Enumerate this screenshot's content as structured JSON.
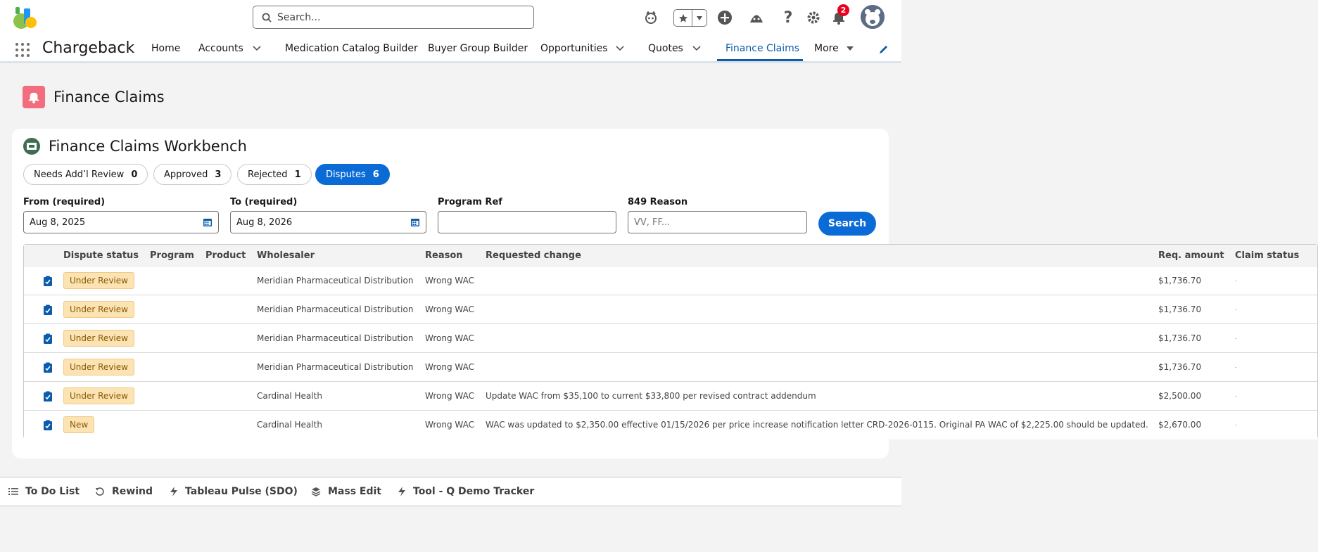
{
  "header": {
    "search_placeholder": "Search...",
    "notification_count": "2"
  },
  "nav": {
    "app_name": "Chargeback",
    "items": [
      {
        "label": "Home"
      },
      {
        "label": "Accounts"
      },
      {
        "label": "Medication Catalog Builder"
      },
      {
        "label": "Buyer Group Builder"
      },
      {
        "label": "Opportunities"
      },
      {
        "label": "Quotes"
      },
      {
        "label": "Finance Claims"
      },
      {
        "label": "More"
      }
    ],
    "active": "Finance Claims"
  },
  "page": {
    "title": "Finance Claims"
  },
  "workbench": {
    "title": "Finance Claims Workbench",
    "tabs": [
      {
        "label": "Needs Add’l Review",
        "count": "0"
      },
      {
        "label": "Approved",
        "count": "3"
      },
      {
        "label": "Rejected",
        "count": "1"
      },
      {
        "label": "Disputes",
        "count": "6"
      }
    ],
    "active_tab": "Disputes",
    "filters": {
      "from_label": "From (required)",
      "from_value": "Aug 8, 2025",
      "to_label": "To (required)",
      "to_value": "Aug 8, 2026",
      "program_label": "Program Ref",
      "program_value": "",
      "reason_label": "849 Reason",
      "reason_placeholder": "VV, FF..."
    },
    "search_label": "Search",
    "columns": [
      "Dispute status",
      "Program",
      "Product",
      "Wholesaler",
      "Reason",
      "Requested change",
      "Req. amount",
      "Claim status"
    ],
    "rows": [
      {
        "status": "Under Review",
        "program": "",
        "product": "",
        "wholesaler": "Meridian Pharmaceutical Distribution",
        "reason": "Wrong WAC",
        "change": "",
        "amount": "$1,736.70",
        "claim_status": ""
      },
      {
        "status": "Under Review",
        "program": "",
        "product": "",
        "wholesaler": "Meridian Pharmaceutical Distribution",
        "reason": "Wrong WAC",
        "change": "",
        "amount": "$1,736.70",
        "claim_status": ""
      },
      {
        "status": "Under Review",
        "program": "",
        "product": "",
        "wholesaler": "Meridian Pharmaceutical Distribution",
        "reason": "Wrong WAC",
        "change": "",
        "amount": "$1,736.70",
        "claim_status": ""
      },
      {
        "status": "Under Review",
        "program": "",
        "product": "",
        "wholesaler": "Meridian Pharmaceutical Distribution",
        "reason": "Wrong WAC",
        "change": "",
        "amount": "$1,736.70",
        "claim_status": ""
      },
      {
        "status": "Under Review",
        "program": "",
        "product": "",
        "wholesaler": "Cardinal Health",
        "reason": "Wrong WAC",
        "change": "Update WAC from $35,100 to current $33,800 per revised contract addendum",
        "amount": "$2,500.00",
        "claim_status": ""
      },
      {
        "status": "New",
        "program": "",
        "product": "",
        "wholesaler": "Cardinal Health",
        "reason": "Wrong WAC",
        "change": "WAC was updated to $2,350.00 effective 01/15/2026 per price increase notification letter CRD-2026-0115. Original PA WAC of $2,225.00 should be updated.",
        "amount": "$2,670.00",
        "claim_status": ""
      }
    ]
  },
  "utility_bar": {
    "items": [
      {
        "label": "To Do List",
        "icon": "list-icon"
      },
      {
        "label": "Rewind",
        "icon": "rewind-icon"
      },
      {
        "label": "Tableau Pulse (SDO)",
        "icon": "lightning-icon"
      },
      {
        "label": "Mass Edit",
        "icon": "layers-icon"
      },
      {
        "label": "Tool - Q Demo Tracker",
        "icon": "lightning-icon"
      }
    ]
  }
}
